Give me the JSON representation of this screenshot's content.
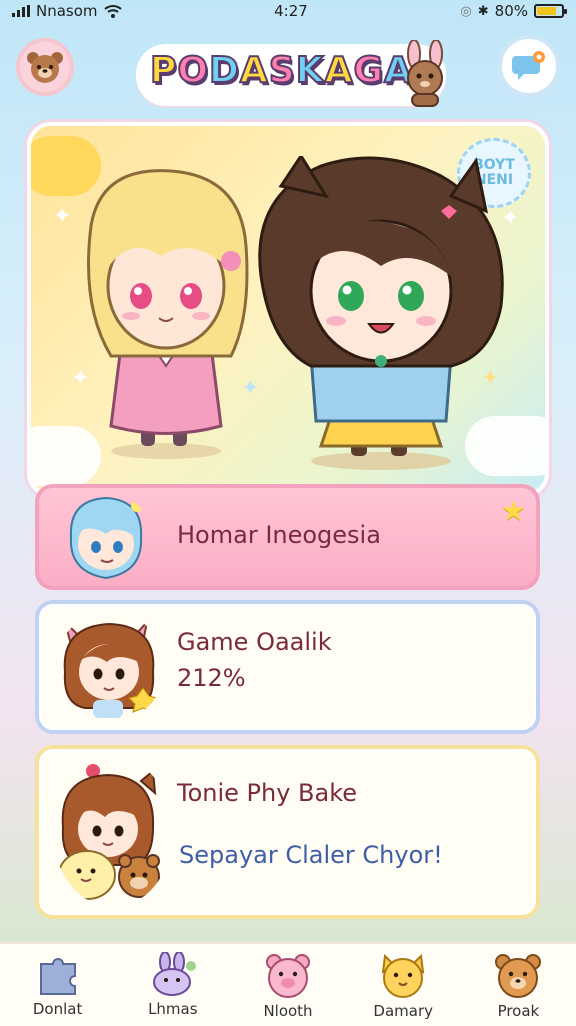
{
  "status_bar": {
    "carrier": "Nnasom",
    "time": "4:27",
    "battery": "80%",
    "battery_level": 0.8
  },
  "header": {
    "title": "PODASKAGA",
    "left_icon": "bear-face-icon",
    "right_icon": "chat-bubble-icon"
  },
  "hero": {
    "badge_text": "BOYT NENI"
  },
  "cards": [
    {
      "title": "Homar Ineogesia",
      "subtitle": ""
    },
    {
      "title": "Game Oaalik",
      "subtitle": "212%"
    },
    {
      "title": "Tonie Phy Bake",
      "subtitle": "Sepayar Claler Chyor!"
    }
  ],
  "nav": [
    {
      "label": "Donlat",
      "icon": "puzzle-icon"
    },
    {
      "label": "Lhmas",
      "icon": "bunny-icon"
    },
    {
      "label": "Nlooth",
      "icon": "pig-face-icon"
    },
    {
      "label": "Damary",
      "icon": "cat-face-icon"
    },
    {
      "label": "Proak",
      "icon": "bear-face-icon"
    }
  ],
  "colors": {
    "accent_pink": "#f8a9c3",
    "accent_blue": "#a9d6f1",
    "accent_yellow": "#f6dd8e"
  }
}
